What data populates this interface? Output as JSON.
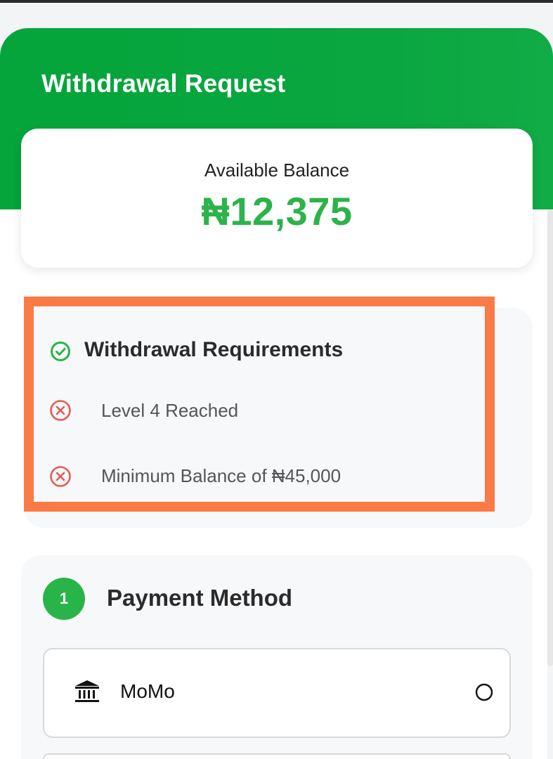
{
  "page": {
    "title": "Withdrawal Request",
    "accent_color": "#0aa640"
  },
  "balance": {
    "label": "Available Balance",
    "value": "₦12,375",
    "value_color": "#2cb34a"
  },
  "requirements": {
    "title": "Withdrawal Requirements",
    "title_icon": "check-circle-icon",
    "items": [
      {
        "label": "Level 4 Reached",
        "status_icon": "x-circle-icon"
      },
      {
        "label": "Minimum Balance of ₦45,000",
        "status_icon": "x-circle-icon"
      }
    ],
    "highlight_color": "#fb7a45"
  },
  "payment": {
    "step_number": "1",
    "title": "Payment Method",
    "options": [
      {
        "label": "MoMo",
        "icon": "bank-icon",
        "selected": false
      }
    ]
  }
}
